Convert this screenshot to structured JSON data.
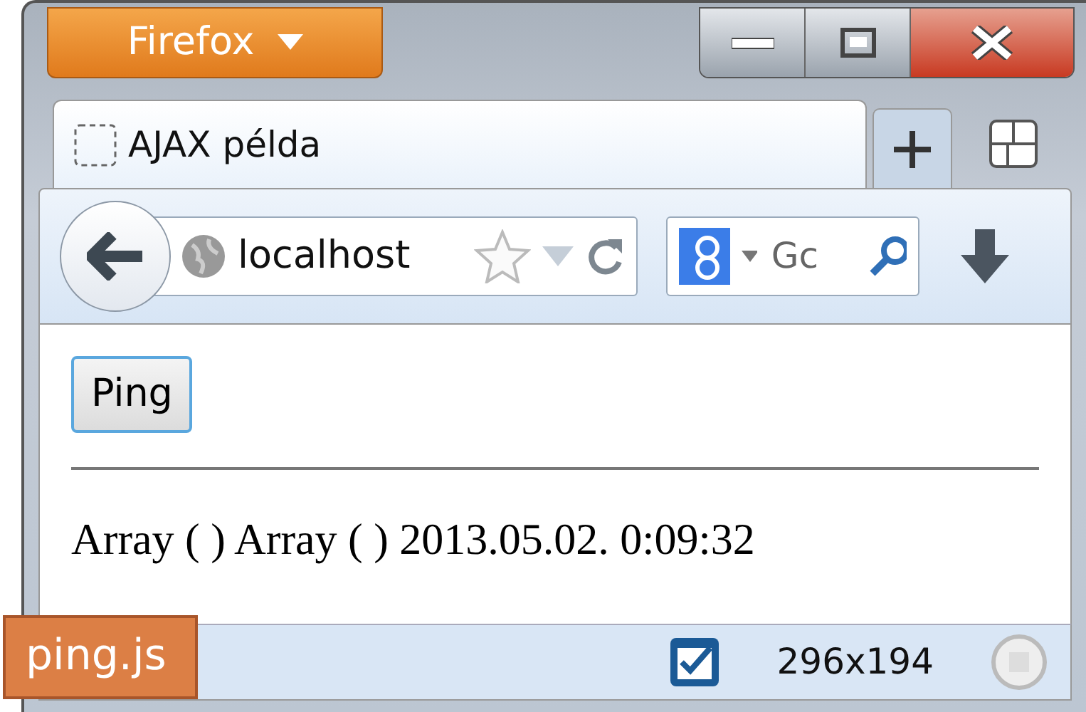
{
  "window": {
    "menu_button": "Firefox"
  },
  "tabs": [
    {
      "title": "AJAX példa",
      "selected": true
    }
  ],
  "toolbar": {
    "address": "localhost",
    "search_placeholder": "Gc"
  },
  "page": {
    "button": "Ping",
    "output": "Array ( ) Array ( ) 2013.05.02. 0:09:32"
  },
  "status_bar": {
    "checked": true,
    "size": "296x194"
  },
  "caption": "ping.js"
}
